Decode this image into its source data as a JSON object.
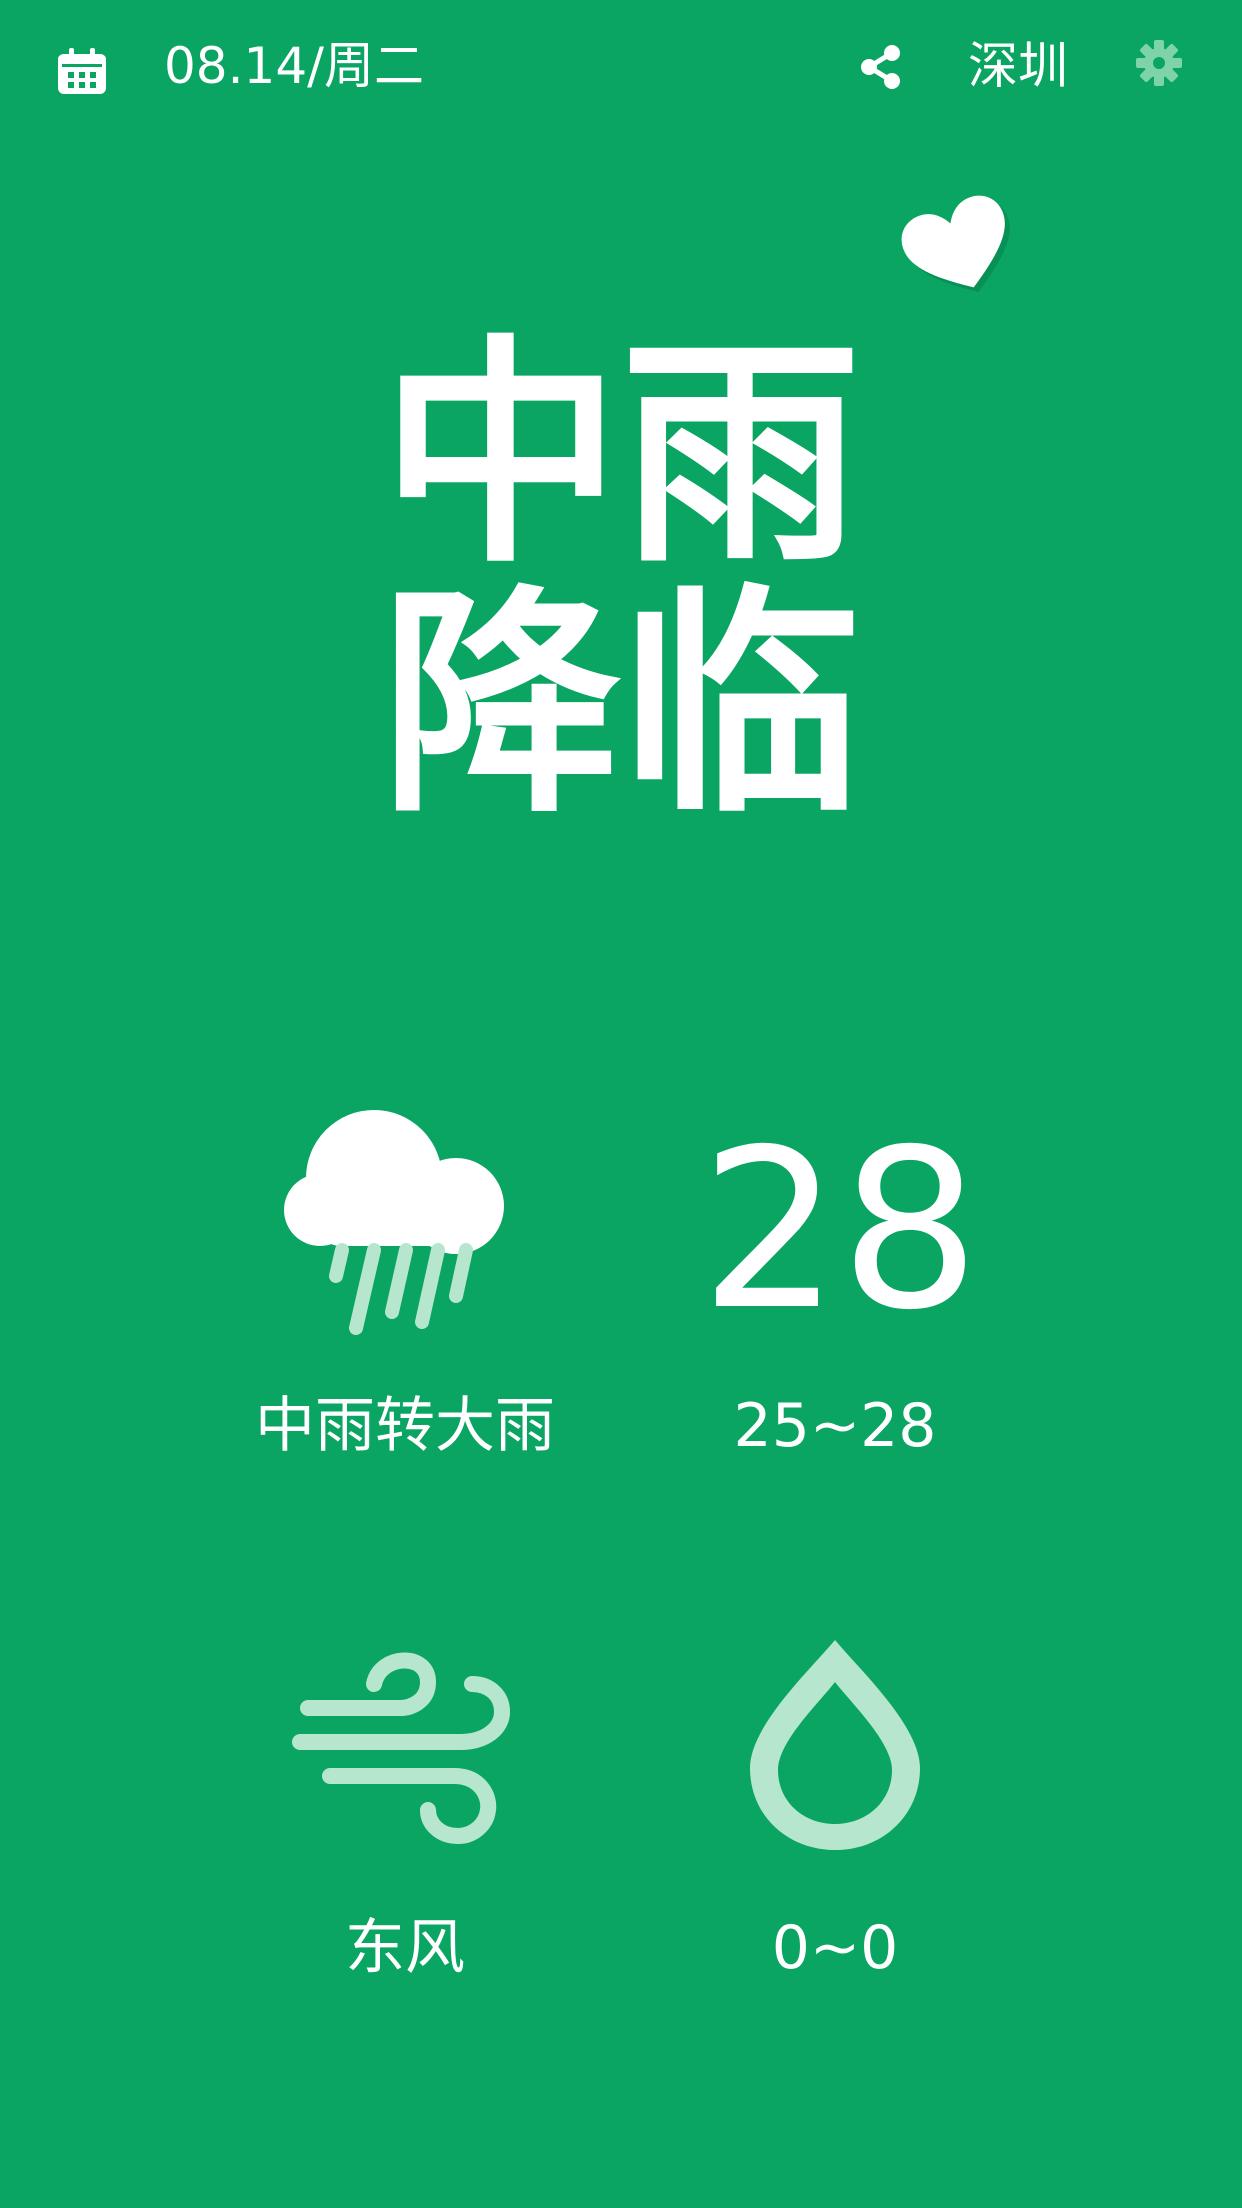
{
  "header": {
    "date": "08.14/周二",
    "city": "深圳",
    "icons": {
      "calendar": "calendar-icon",
      "share": "share-icon",
      "settings": "gear-icon"
    }
  },
  "favorite": {
    "icon": "heart-icon"
  },
  "headline": {
    "line1": "中雨",
    "line2": "降临"
  },
  "weather": {
    "condition_icon": "rain-cloud-icon",
    "condition": "中雨转大雨",
    "temperature": "28",
    "temperature_range": "25~28",
    "wind_icon": "wind-icon",
    "wind": "东风",
    "humidity_icon": "water-drop-icon",
    "humidity": "0~0"
  },
  "colors": {
    "background": "#0AA563",
    "foreground": "#FFFFFF",
    "muted_icon": "#B7E6CE"
  }
}
